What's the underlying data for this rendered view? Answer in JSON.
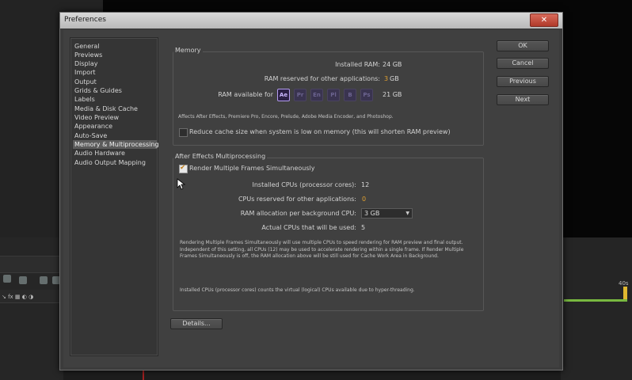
{
  "dialog": {
    "title": "Preferences",
    "close_glyph": "✕"
  },
  "categories": [
    {
      "label": "General"
    },
    {
      "label": "Previews"
    },
    {
      "label": "Display"
    },
    {
      "label": "Import"
    },
    {
      "label": "Output"
    },
    {
      "label": "Grids & Guides"
    },
    {
      "label": "Labels"
    },
    {
      "label": "Media & Disk Cache"
    },
    {
      "label": "Video Preview"
    },
    {
      "label": "Appearance"
    },
    {
      "label": "Auto-Save"
    },
    {
      "label": "Memory & Multiprocessing",
      "selected": true
    },
    {
      "label": "Audio Hardware"
    },
    {
      "label": "Audio Output Mapping"
    }
  ],
  "memory": {
    "title": "Memory",
    "installed_ram_label": "Installed RAM:",
    "installed_ram_value": "24 GB",
    "reserved_label": "RAM reserved for other applications:",
    "reserved_value": "3",
    "reserved_unit": "GB",
    "available_label": "RAM available for",
    "available_value": "21 GB",
    "apps": [
      "Ae",
      "Pr",
      "En",
      "Pl",
      "B",
      "Ps"
    ],
    "affects_text": "Affects After Effects, Premiere Pro, Encore, Prelude, Adobe Media Encoder, and Photoshop.",
    "reduce_cache_label": "Reduce cache size when system is low on memory (this will shorten RAM preview)",
    "reduce_cache_checked": false
  },
  "multiprocessing": {
    "title": "After Effects Multiprocessing",
    "render_multiple_label": "Render Multiple Frames Simultaneously",
    "render_multiple_checked": true,
    "installed_cpus_label": "Installed CPUs (processor cores):",
    "installed_cpus_value": "12",
    "cpus_reserved_label": "CPUs reserved for other applications:",
    "cpus_reserved_value": "0",
    "ram_alloc_label": "RAM allocation per background CPU:",
    "ram_alloc_value": "3 GB",
    "actual_cpus_label": "Actual CPUs that will be used:",
    "actual_cpus_value": "5",
    "description": "Rendering Multiple Frames Simultaneously will use multiple CPUs to speed rendering for RAM preview and final output. Independent of this setting, all CPUs (12) may be used to accelerate rendering within a single frame. If Render Multiple Frames Simultaneously is off, the RAM allocation above will be still used for Cache Work Area in Background.",
    "note": "Installed CPUs (processor cores) counts the virtual (logical) CPUs available due to hyper-threading."
  },
  "buttons": {
    "ok": "OK",
    "cancel": "Cancel",
    "previous": "Previous",
    "next": "Next",
    "details": "Details..."
  },
  "background": {
    "label_40s": "40s"
  }
}
